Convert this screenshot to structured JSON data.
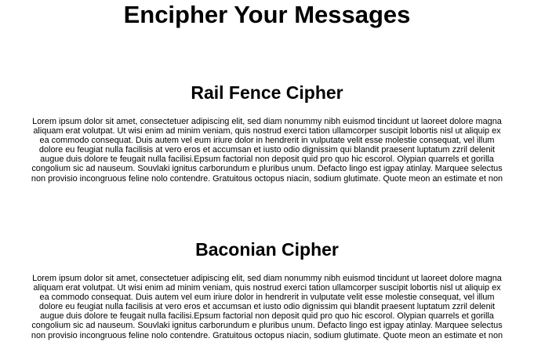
{
  "page": {
    "title": "Encipher Your Messages"
  },
  "sections": [
    {
      "title": "Rail Fence Cipher",
      "lines": [
        "Lorem ipsum dolor sit amet, consectetuer adipiscing elit, sed diam nonummy nibh euismod tincidunt ut laoreet dolore magna",
        "aliquam erat volutpat. Ut wisi enim ad minim veniam, quis nostrud exerci tation ullamcorper suscipit lobortis nisl ut aliquip ex",
        "ea commodo consequat. Duis autem vel eum iriure dolor in hendrerit in vulputate velit esse molestie consequat, vel illum",
        "dolore eu feugiat nulla facilisis at vero eros et accumsan et iusto odio dignissim qui blandit praesent luptatum zzril delenit",
        "augue duis dolore te feugait nulla facilisi.Epsum factorial non deposit quid pro quo hic escorol. Olypian quarrels et gorilla",
        "congolium sic ad nauseum. Souvlaki ignitus carborundum e pluribus unum. Defacto lingo est igpay atinlay. Marquee selectus",
        "non provisio incongruous feline nolo contendre. Gratuitous octopus niacin, sodium glutimate. Quote meon an estimate et non"
      ]
    },
    {
      "title": "Baconian Cipher",
      "lines": [
        "Lorem ipsum dolor sit amet, consectetuer adipiscing elit, sed diam nonummy nibh euismod tincidunt ut laoreet dolore magna",
        "aliquam erat volutpat. Ut wisi enim ad minim veniam, quis nostrud exerci tation ullamcorper suscipit lobortis nisl ut aliquip ex",
        "ea commodo consequat. Duis autem vel eum iriure dolor in hendrerit in vulputate velit esse molestie consequat, vel illum",
        "dolore eu feugiat nulla facilisis at vero eros et accumsan et iusto odio dignissim qui blandit praesent luptatum zzril delenit",
        "augue duis dolore te feugait nulla facilisi.Epsum factorial non deposit quid pro quo hic escorol. Olypian quarrels et gorilla",
        "congolium sic ad nauseum. Souvlaki ignitus carborundum e pluribus unum. Defacto lingo est igpay atinlay. Marquee selectus",
        "non provisio incongruous feline nolo contendre. Gratuitous octopus niacin, sodium glutimate. Quote meon an estimate et non"
      ]
    }
  ]
}
